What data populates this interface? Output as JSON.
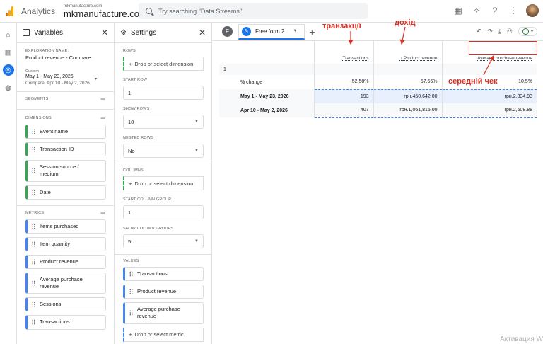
{
  "header": {
    "app_name": "Analytics",
    "account": "mkmanufacture.com",
    "property": "mkmanufacture.com",
    "search_placeholder": "Try searching \"Data Streams\""
  },
  "variables_panel": {
    "title": "Variables",
    "exploration_name_label": "EXPLORATION NAME:",
    "exploration_name": "Product revenue - Compare",
    "date_label": "Custom",
    "date_range": "May 1 - May 23, 2026",
    "compare_range": "Compare: Apr 10 - May 2, 2026",
    "segments_label": "SEGMENTS",
    "dimensions_label": "DIMENSIONS",
    "dimensions": [
      "Event name",
      "Transaction ID",
      "Session source / medium",
      "Date"
    ],
    "metrics_label": "METRICS",
    "metrics": [
      "Items purchased",
      "Item quantity",
      "Product revenue",
      "Average purchase revenue",
      "Sessions",
      "Transactions"
    ]
  },
  "settings_panel": {
    "title": "Settings",
    "rows_label": "ROWS",
    "drop_dimension": "Drop or select dimension",
    "start_row_label": "START ROW",
    "start_row": "1",
    "show_rows_label": "SHOW ROWS",
    "show_rows": "10",
    "nested_rows_label": "NESTED ROWS",
    "nested_rows": "No",
    "columns_label": "COLUMNS",
    "start_column_group_label": "START COLUMN GROUP",
    "start_column_group": "1",
    "show_column_groups_label": "SHOW COLUMN GROUPS",
    "show_column_groups": "5",
    "values_label": "VALUES",
    "values": [
      "Transactions",
      "Product revenue",
      "Average purchase revenue"
    ],
    "drop_metric": "Drop or select metric"
  },
  "tabs": {
    "badge": "F",
    "active_tab": "Free form 2"
  },
  "table": {
    "headers": [
      "Transactions",
      "Product revenue",
      "Average purchase revenue"
    ],
    "sort_marker": "↓",
    "group_row": "1",
    "rows": [
      {
        "label": "% change",
        "values": [
          "-52.58%",
          "-57.56%",
          "-10.5%"
        ]
      },
      {
        "label": "May 1 - May 23, 2026",
        "values": [
          "193",
          "грн.450,642.00",
          "грн.2,334.93"
        ]
      },
      {
        "label": "Apr 10 - May 2, 2026",
        "values": [
          "407",
          "грн.1,061,815.00",
          "грн.2,608.88"
        ]
      }
    ]
  },
  "annotations": {
    "transactions": "транзакції",
    "revenue": "дохід",
    "avg_check": "середній чек"
  },
  "watermark": "Активация W",
  "colors": {
    "accent": "#1a73e8",
    "annotation": "#d93025",
    "dimension": "#34a853",
    "metric": "#4285f4"
  }
}
